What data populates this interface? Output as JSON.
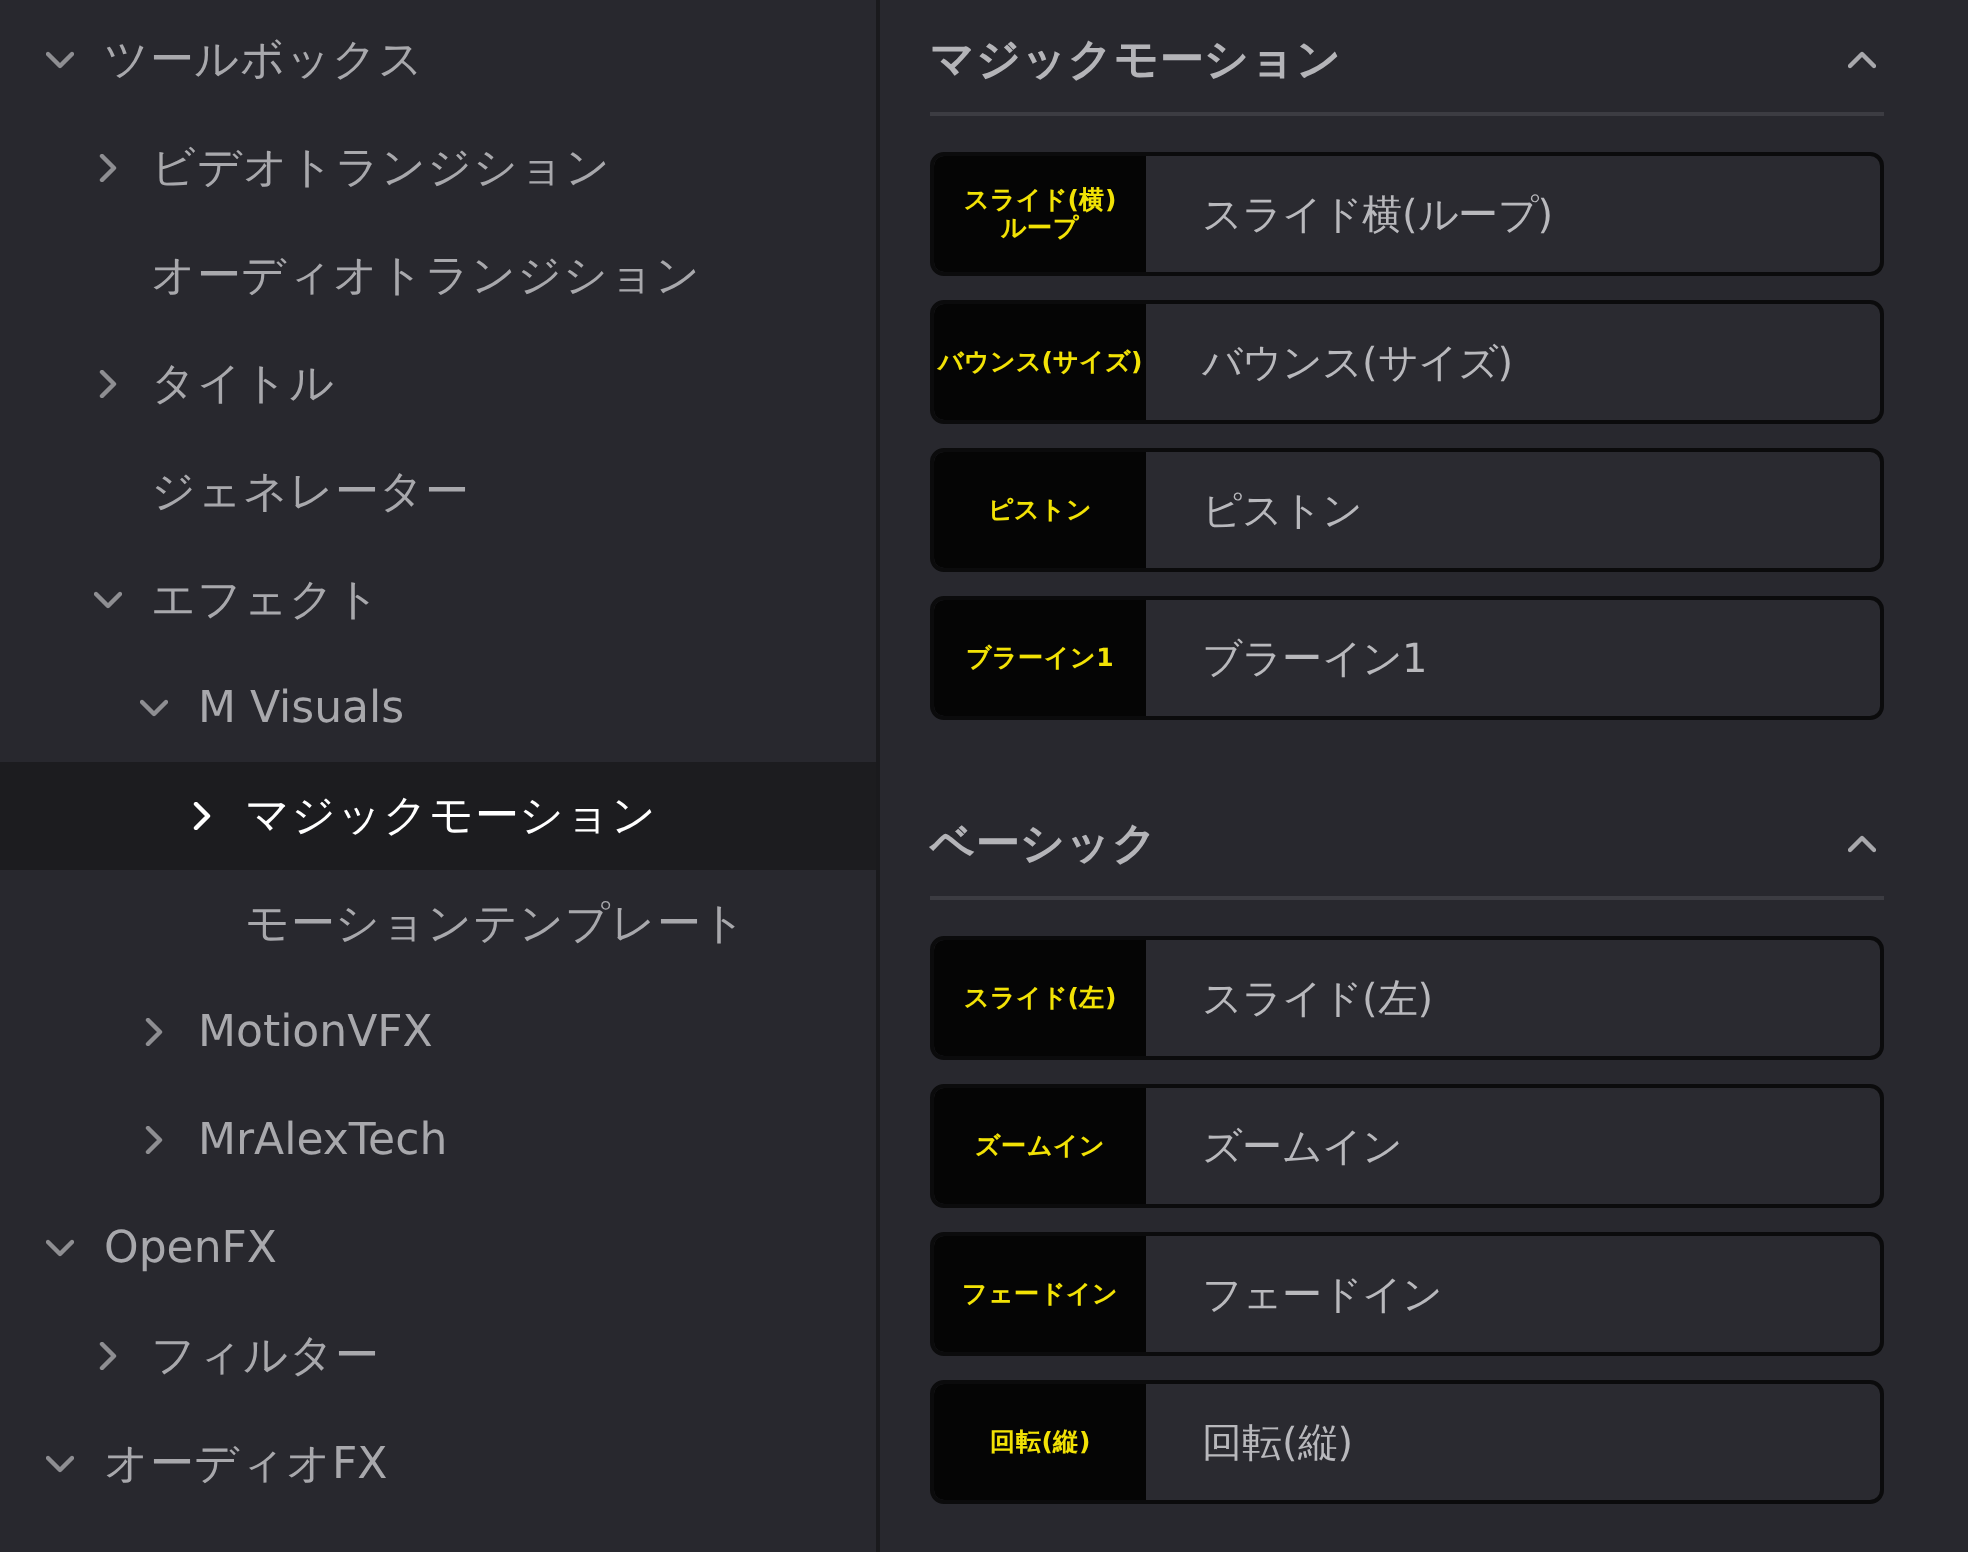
{
  "tree": [
    {
      "label": "ツールボックス",
      "kind": "folder",
      "expanded": true,
      "selected": false,
      "children": [
        {
          "label": "ビデオトランジション",
          "kind": "folder",
          "expanded": false,
          "selected": false
        },
        {
          "label": "オーディオトランジション",
          "kind": "item",
          "selected": false
        },
        {
          "label": "タイトル",
          "kind": "folder",
          "expanded": false,
          "selected": false
        },
        {
          "label": "ジェネレーター",
          "kind": "item",
          "selected": false
        },
        {
          "label": "エフェクト",
          "kind": "folder",
          "expanded": true,
          "selected": false,
          "children": [
            {
              "label": "M Visuals",
              "kind": "folder",
              "expanded": true,
              "selected": false,
              "children": [
                {
                  "label": "マジックモーション",
                  "kind": "folder",
                  "expanded": false,
                  "selected": true
                },
                {
                  "label": "モーションテンプレート",
                  "kind": "item",
                  "selected": false
                }
              ]
            },
            {
              "label": "MotionVFX",
              "kind": "folder",
              "expanded": false,
              "selected": false
            },
            {
              "label": "MrAlexTech",
              "kind": "folder",
              "expanded": false,
              "selected": false
            }
          ]
        }
      ]
    },
    {
      "label": "OpenFX",
      "kind": "folder",
      "expanded": true,
      "selected": false,
      "children": [
        {
          "label": "フィルター",
          "kind": "folder",
          "expanded": false,
          "selected": false
        }
      ]
    },
    {
      "label": "オーディオFX",
      "kind": "folder",
      "expanded": true,
      "selected": false
    }
  ],
  "sections": [
    {
      "title": "マジックモーション",
      "expanded": true,
      "items": [
        {
          "thumb": "スライド(横)\nループ",
          "name": "スライド横(ループ)"
        },
        {
          "thumb": "バウンス(サイズ)",
          "name": "バウンス(サイズ)"
        },
        {
          "thumb": "ピストン",
          "name": "ピストン"
        },
        {
          "thumb": "ブラーイン1",
          "name": "ブラーイン1"
        }
      ]
    },
    {
      "title": "ベーシック",
      "expanded": true,
      "items": [
        {
          "thumb": "スライド(左)",
          "name": "スライド(左)"
        },
        {
          "thumb": "ズームイン",
          "name": "ズームイン"
        },
        {
          "thumb": "フェードイン",
          "name": "フェードイン"
        },
        {
          "thumb": "回転(縦)",
          "name": "回転(縦)"
        }
      ]
    }
  ]
}
